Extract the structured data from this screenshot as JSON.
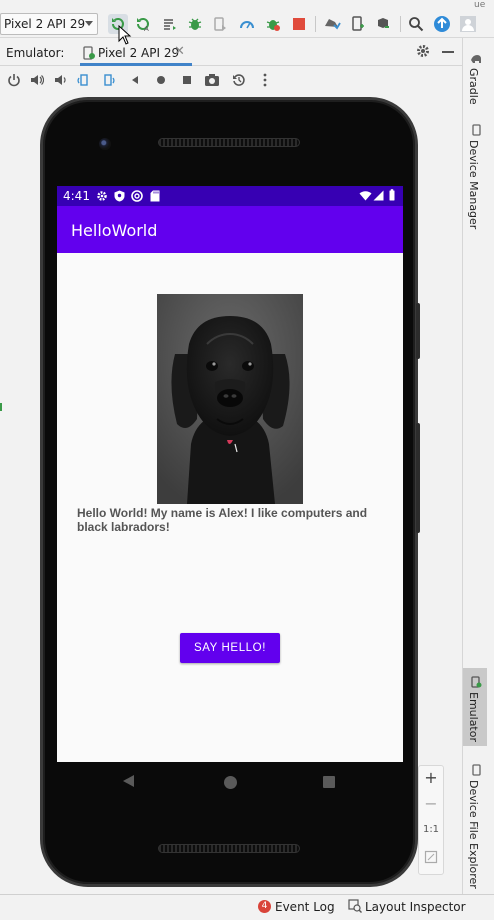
{
  "toolbar": {
    "device_selector": "Pixel 2 API 29",
    "icons": [
      "apply-changes-icon",
      "apply-code-changes-icon",
      "logcat-icon",
      "debug-icon",
      "attach-debugger-icon",
      "profile-icon",
      "run-with-coverage-icon",
      "stop-icon",
      "sync-icon",
      "device-manager-icon",
      "sdk-manager-icon",
      "search-icon",
      "update-icon",
      "account-icon"
    ]
  },
  "tabbar": {
    "label": "Emulator:",
    "tab_label": "Pixel 2 API 29"
  },
  "sidebar_right": {
    "items": [
      "Gradle",
      "Device Manager",
      "Emulator",
      "Device File Explorer"
    ]
  },
  "phone": {
    "status_time": "4:41",
    "app_title": "HelloWorld",
    "greeting": "Hello World! My name is Alex! I like computers and black labradors!",
    "button_label": "SAY HELLO!"
  },
  "zoom": {
    "zoom_in": "+",
    "zoom_out": "−",
    "actual_size": "1:1"
  },
  "statusbar": {
    "event_count": "4",
    "event_log": "Event Log",
    "layout_inspector": "Layout Inspector"
  }
}
